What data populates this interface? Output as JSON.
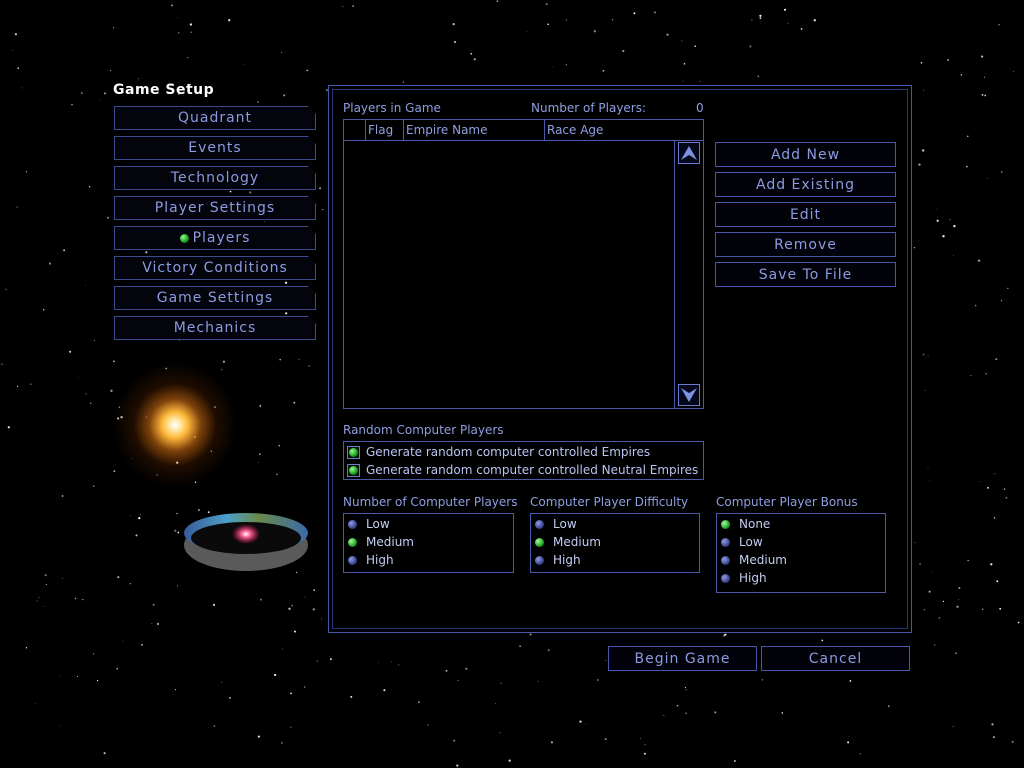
{
  "heading": "Game Setup",
  "nav": [
    {
      "label": "Quadrant",
      "active": false
    },
    {
      "label": "Events",
      "active": false
    },
    {
      "label": "Technology",
      "active": false
    },
    {
      "label": "Player Settings",
      "active": false
    },
    {
      "label": "Players",
      "active": true
    },
    {
      "label": "Victory Conditions",
      "active": false
    },
    {
      "label": "Game Settings",
      "active": false
    },
    {
      "label": "Mechanics",
      "active": false
    }
  ],
  "players": {
    "title": "Players in Game",
    "count_label": "Number of Players:",
    "count": "0",
    "columns": [
      "",
      "Flag",
      "Empire Name",
      "Race Age"
    ],
    "rows": []
  },
  "actions": {
    "add_new": "Add New",
    "add_existing": "Add Existing",
    "edit": "Edit",
    "remove": "Remove",
    "save_to_file": "Save To File"
  },
  "random": {
    "title": "Random Computer Players",
    "options": [
      {
        "label": "Generate random computer controlled Empires",
        "checked": true
      },
      {
        "label": "Generate random computer controlled Neutral Empires",
        "checked": true
      }
    ]
  },
  "num_computer": {
    "title": "Number of Computer Players",
    "options": [
      "Low",
      "Medium",
      "High"
    ],
    "selected": "Medium"
  },
  "difficulty": {
    "title": "Computer Player Difficulty",
    "options": [
      "Low",
      "Medium",
      "High"
    ],
    "selected": "Medium"
  },
  "bonus": {
    "title": "Computer Player Bonus",
    "options": [
      "None",
      "Low",
      "Medium",
      "High"
    ],
    "selected": "None"
  },
  "footer": {
    "begin": "Begin Game",
    "cancel": "Cancel"
  },
  "colors": {
    "accent": "#4656a8",
    "text": "#8c9be0",
    "led_on": "#17b017"
  },
  "icons": {
    "scroll_up": "arrow-up-icon",
    "scroll_down": "arrow-down-icon"
  }
}
